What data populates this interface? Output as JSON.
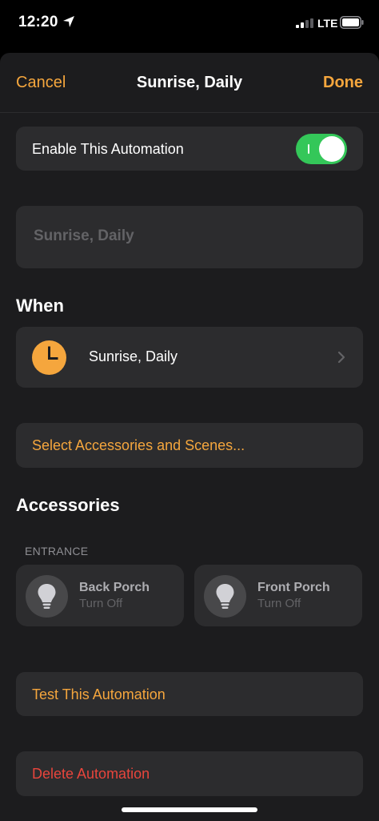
{
  "status_bar": {
    "time": "12:20",
    "network": "LTE"
  },
  "nav": {
    "cancel_label": "Cancel",
    "title": "Sunrise, Daily",
    "done_label": "Done"
  },
  "enable": {
    "label": "Enable This Automation",
    "toggle_on": true
  },
  "name_field": {
    "placeholder": "Sunrise, Daily"
  },
  "when": {
    "header": "When",
    "trigger_label": "Sunrise, Daily",
    "icon": "clock-icon"
  },
  "select_accessories": {
    "label": "Select Accessories and Scenes..."
  },
  "accessories": {
    "header": "Accessories",
    "group": "ENTRANCE",
    "items": [
      {
        "name": "Back Porch",
        "action": "Turn Off",
        "icon": "lightbulb-icon"
      },
      {
        "name": "Front Porch",
        "action": "Turn Off",
        "icon": "lightbulb-icon"
      }
    ]
  },
  "test": {
    "label": "Test This Automation"
  },
  "delete": {
    "label": "Delete Automation"
  },
  "colors": {
    "accent": "#f5a63d",
    "toggle_on": "#34c759",
    "destructive": "#e8453c",
    "background": "#1c1c1e",
    "card": "#2c2c2e"
  }
}
